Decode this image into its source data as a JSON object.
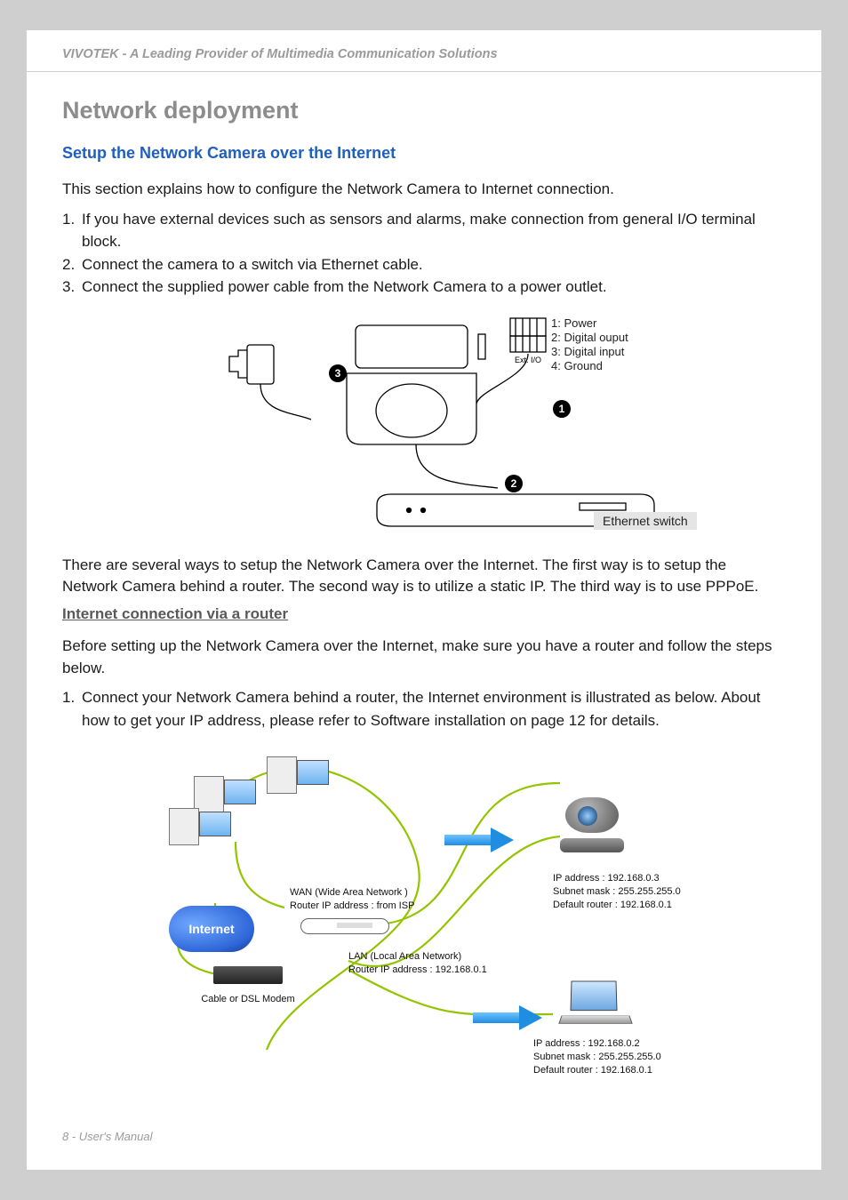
{
  "header": {
    "brand": "VIVOTEK - A Leading Provider of Multimedia Communication Solutions"
  },
  "title": "Network deployment",
  "subtitle": "Setup the Network Camera over the Internet",
  "intro": "This section explains how to configure the Network Camera to Internet connection.",
  "steps_a": {
    "s1_num": "1.",
    "s1_txt": "If you have external devices such as sensors and alarms, make connection from general I/O terminal block.",
    "s2_num": "2.",
    "s2_txt": "Connect the camera to a switch via Ethernet cable.",
    "s3_num": "3.",
    "s3_txt": "Connect the supplied power cable from the Network Camera to a power outlet."
  },
  "diag1": {
    "pins": {
      "p1": "1: Power",
      "p2": "2: Digital ouput",
      "p3": "3: Digital input",
      "p4": "4: Ground"
    },
    "ext_io": "Ext. I/O",
    "ethernet_switch": "Ethernet switch",
    "badge1": "1",
    "badge2": "2",
    "badge3": "3"
  },
  "para_ways": "There are several ways to setup the Network Camera over the Internet. The first way is to setup the Network Camera behind a router. The second way is to utilize a static IP. The third way is to use PPPoE.",
  "section_internet_router": "Internet connection via a router",
  "para_before": "Before setting up the Network Camera over the Internet, make sure you have a router and follow the steps below.",
  "steps_b": {
    "s1_num": "1.",
    "s1_txt": "Connect your Network Camera behind a router, the Internet environment is illustrated as below. About how to get your IP address, please refer to Software installation on page 12 for details."
  },
  "diag2": {
    "internet": "Internet",
    "wan_line1": "WAN (Wide Area Network )",
    "wan_line2": "Router IP address : from ISP",
    "lan_line1": "LAN (Local Area Network)",
    "lan_line2": "Router IP address : 192.168.0.1",
    "modem": "Cable or DSL Modem",
    "cam_ip": "IP address : 192.168.0.3",
    "cam_mask": "Subnet mask : 255.255.255.0",
    "cam_gw": "Default router : 192.168.0.1",
    "laptop_ip": "IP address : 192.168.0.2",
    "laptop_mask": "Subnet mask : 255.255.255.0",
    "laptop_gw": "Default router : 192.168.0.1"
  },
  "footer": "8 - User's Manual"
}
